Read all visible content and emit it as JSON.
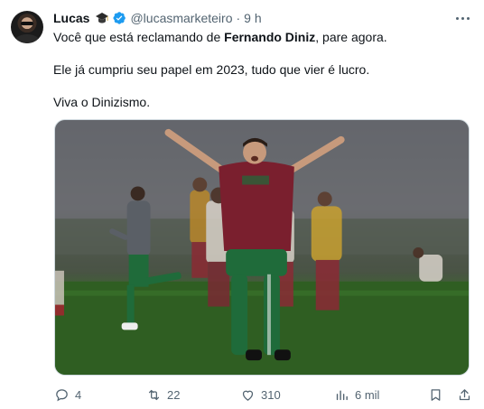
{
  "author": {
    "name": "Lucas",
    "handle": "@lucasmarketeiro",
    "separator": "·",
    "time": "9 h"
  },
  "tweet": {
    "line1_before": "Você que está reclamando de ",
    "line1_bold": "Fernando Diniz",
    "line1_after": ", pare agora.",
    "line2": "Ele já cumpriu seu papel em 2023, tudo que vier é lucro.",
    "line3": "Viva o Dinizismo."
  },
  "actions": {
    "replies": "4",
    "reposts": "22",
    "likes": "310",
    "views": "6 mil"
  },
  "colors": {
    "text": "#0f1419",
    "secondary": "#536471",
    "verified": "#1d9bf0",
    "jersey_maroon": "#7a1f2e",
    "jersey_green": "#1f6b3a",
    "pitch": "#2f5e22"
  },
  "icons": [
    "graduation-cap-icon",
    "verified-icon",
    "more-icon",
    "reply-icon",
    "repost-icon",
    "like-icon",
    "views-icon",
    "bookmark-icon",
    "share-icon"
  ]
}
